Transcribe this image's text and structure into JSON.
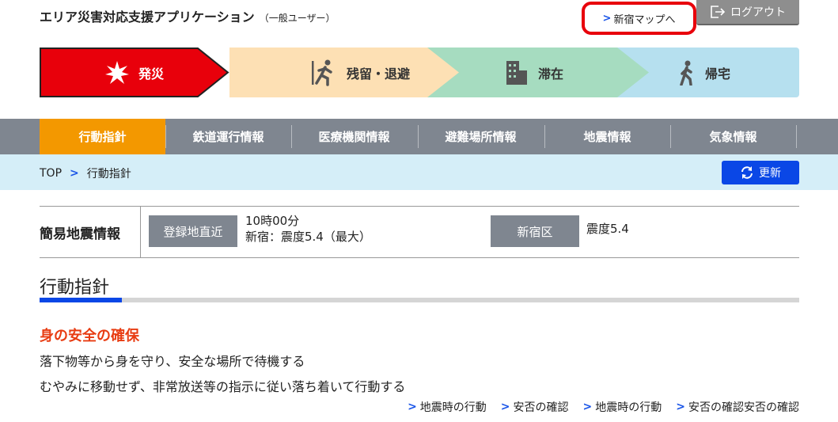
{
  "header": {
    "title": "エリア災害対応支援アプリケーション",
    "subtitle": "（一般ユーザー）",
    "map_link": "新宿マップへ",
    "logout": "ログアウト"
  },
  "phases": [
    {
      "label": "発災",
      "icon": "burst-icon",
      "color": "#e8000b"
    },
    {
      "label": "残留・退避",
      "icon": "running-person-icon",
      "color": "#fde0b4"
    },
    {
      "label": "滞在",
      "icon": "building-icon",
      "color": "#a6dcc0"
    },
    {
      "label": "帰宅",
      "icon": "walking-person-icon",
      "color": "#b6e0ef"
    }
  ],
  "nav": {
    "items": [
      "行動指針",
      "鉄道運行情報",
      "医療機関情報",
      "避難場所情報",
      "地震情報",
      "気象情報"
    ],
    "active": "行動指針"
  },
  "breadcrumb": {
    "home": "TOP",
    "current": "行動指針"
  },
  "refresh_label": "更新",
  "earthquake": {
    "title": "簡易地震情報",
    "badge_1": "登録地直近",
    "time": "10時00分",
    "detail": "新宿：震度5.4（最大）",
    "badge_2": "新宿区",
    "region_detail": "震度5.4"
  },
  "guidance": {
    "heading": "行動指針",
    "safety_heading": "身の安全の確保",
    "line_1": "落下物等から身を守り、安全な場所で待機する",
    "line_2": "むやみに移動せず、非常放送等の指示に従い落ち着いて行動する",
    "links": [
      "地震時の行動",
      "安否の確認",
      "地震時の行動",
      "安否の確認安否の確認"
    ]
  }
}
